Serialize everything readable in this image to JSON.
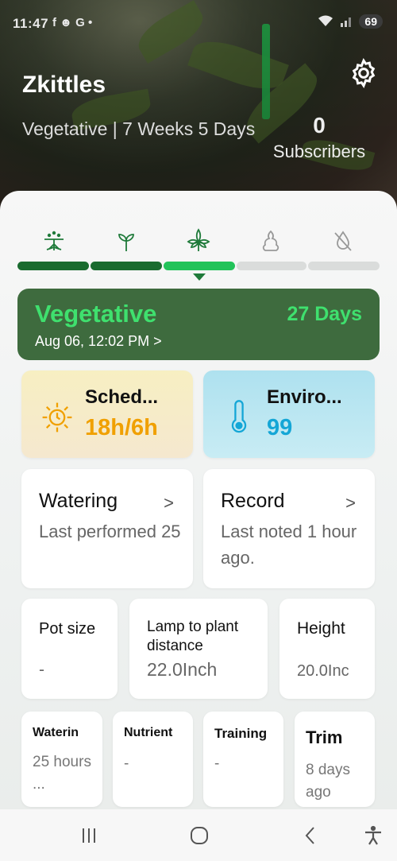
{
  "status_bar": {
    "time": "11:47",
    "notif_icons": "f ☻ G •",
    "battery": "69"
  },
  "header": {
    "title": "Zkittles",
    "stage_text": "Vegetative | 7 Weeks 5 Days",
    "subscribers_count": "0",
    "subscribers_label": "Subscribers"
  },
  "stages": [
    {
      "name": "germination-icon"
    },
    {
      "name": "seedling-icon"
    },
    {
      "name": "vegetative-icon"
    },
    {
      "name": "flowering-icon"
    },
    {
      "name": "harvest-icon"
    }
  ],
  "current_stage": {
    "title": "Vegetative",
    "days": "27 Days",
    "start": "Aug 06, 12:02 PM >"
  },
  "schedule": {
    "title": "Sched...",
    "value": "18h/6h"
  },
  "environment": {
    "title": "Enviro...",
    "value": "99"
  },
  "watering": {
    "title": "Watering",
    "text": "Last performed 25"
  },
  "record": {
    "title": "Record",
    "text": "Last noted 1 hour ago."
  },
  "pot_size": {
    "title": "Pot size",
    "value": "-"
  },
  "lamp": {
    "title": "Lamp to plant distance",
    "value": "22.0Inch"
  },
  "height": {
    "title": "Height",
    "value": "20.0Inc"
  },
  "small_tiles": [
    {
      "title": "Waterin",
      "value": "25 hours ..."
    },
    {
      "title": "Nutrient",
      "value": "-"
    },
    {
      "title": "Training",
      "value": "-"
    },
    {
      "title": "Trim",
      "value": "8 days ago"
    }
  ],
  "colors": {
    "accent": "#1f7a3a",
    "stage_card": "#3e6b3e",
    "stage_text": "#3fe06e",
    "sched_value": "#f0a000",
    "enviro_value": "#14a6d6"
  }
}
